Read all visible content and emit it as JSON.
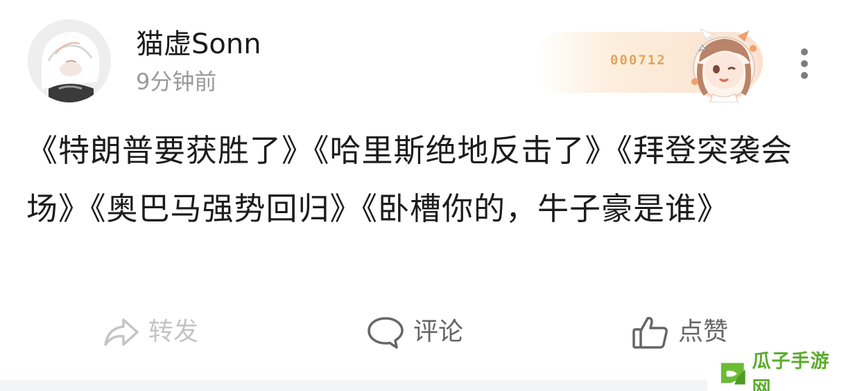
{
  "post": {
    "author": {
      "username": "猫虚Sonn",
      "timestamp": "9分钟前"
    },
    "badge": {
      "number": "000712"
    },
    "content": "《特朗普要获胜了》《哈里斯绝地反击了》《拜登突袭会场》《奥巴马强势回归》《卧槽你的，牛子豪是谁》",
    "actions": {
      "share_label": "转发",
      "comment_label": "评论",
      "like_label": "点赞"
    }
  },
  "watermark": {
    "text": "瓜子手游网"
  },
  "colors": {
    "badge_gold": "#e1a55c",
    "watermark_green": "#5aac2c",
    "text_primary": "#1c1c1c",
    "text_secondary": "#9a9a9a"
  },
  "icons": {
    "share": "share-arrow-icon",
    "comment": "speech-bubble-icon",
    "like": "thumbs-up-icon",
    "more": "vertical-ellipsis-icon"
  }
}
